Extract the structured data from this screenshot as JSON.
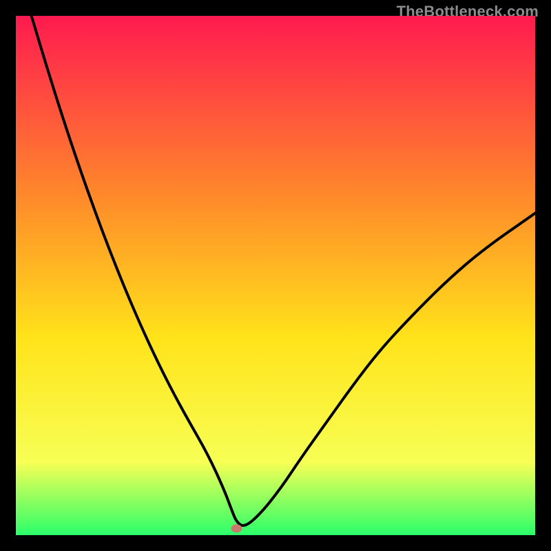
{
  "watermark": "TheBottleneck.com",
  "chart_data": {
    "type": "line",
    "title": "",
    "xlabel": "",
    "ylabel": "",
    "xlim": [
      0,
      100
    ],
    "ylim": [
      0,
      100
    ],
    "x": [
      3,
      6,
      9,
      12,
      15,
      18,
      21,
      24,
      27,
      30,
      33,
      37,
      40,
      41.5,
      42.5,
      44,
      47,
      51,
      55,
      60,
      65,
      70,
      76,
      83,
      90,
      100
    ],
    "values": [
      100,
      90,
      80.5,
      71.5,
      63,
      55,
      47.5,
      40.5,
      34,
      28,
      22.5,
      15.5,
      9,
      5,
      2.5,
      1.5,
      4,
      9,
      15,
      22,
      29,
      35.5,
      42,
      49,
      55,
      62
    ],
    "marker_point": {
      "x": 42.5,
      "y": 1.3
    },
    "gradient_colors": {
      "top": "#ff1a4f",
      "mid_upper": "#ff8a2a",
      "mid": "#ffe31a",
      "lower": "#f7ff55",
      "bottom": "#2aff6a"
    },
    "curve_color": "#000000",
    "marker_color": "#c97a6e"
  }
}
